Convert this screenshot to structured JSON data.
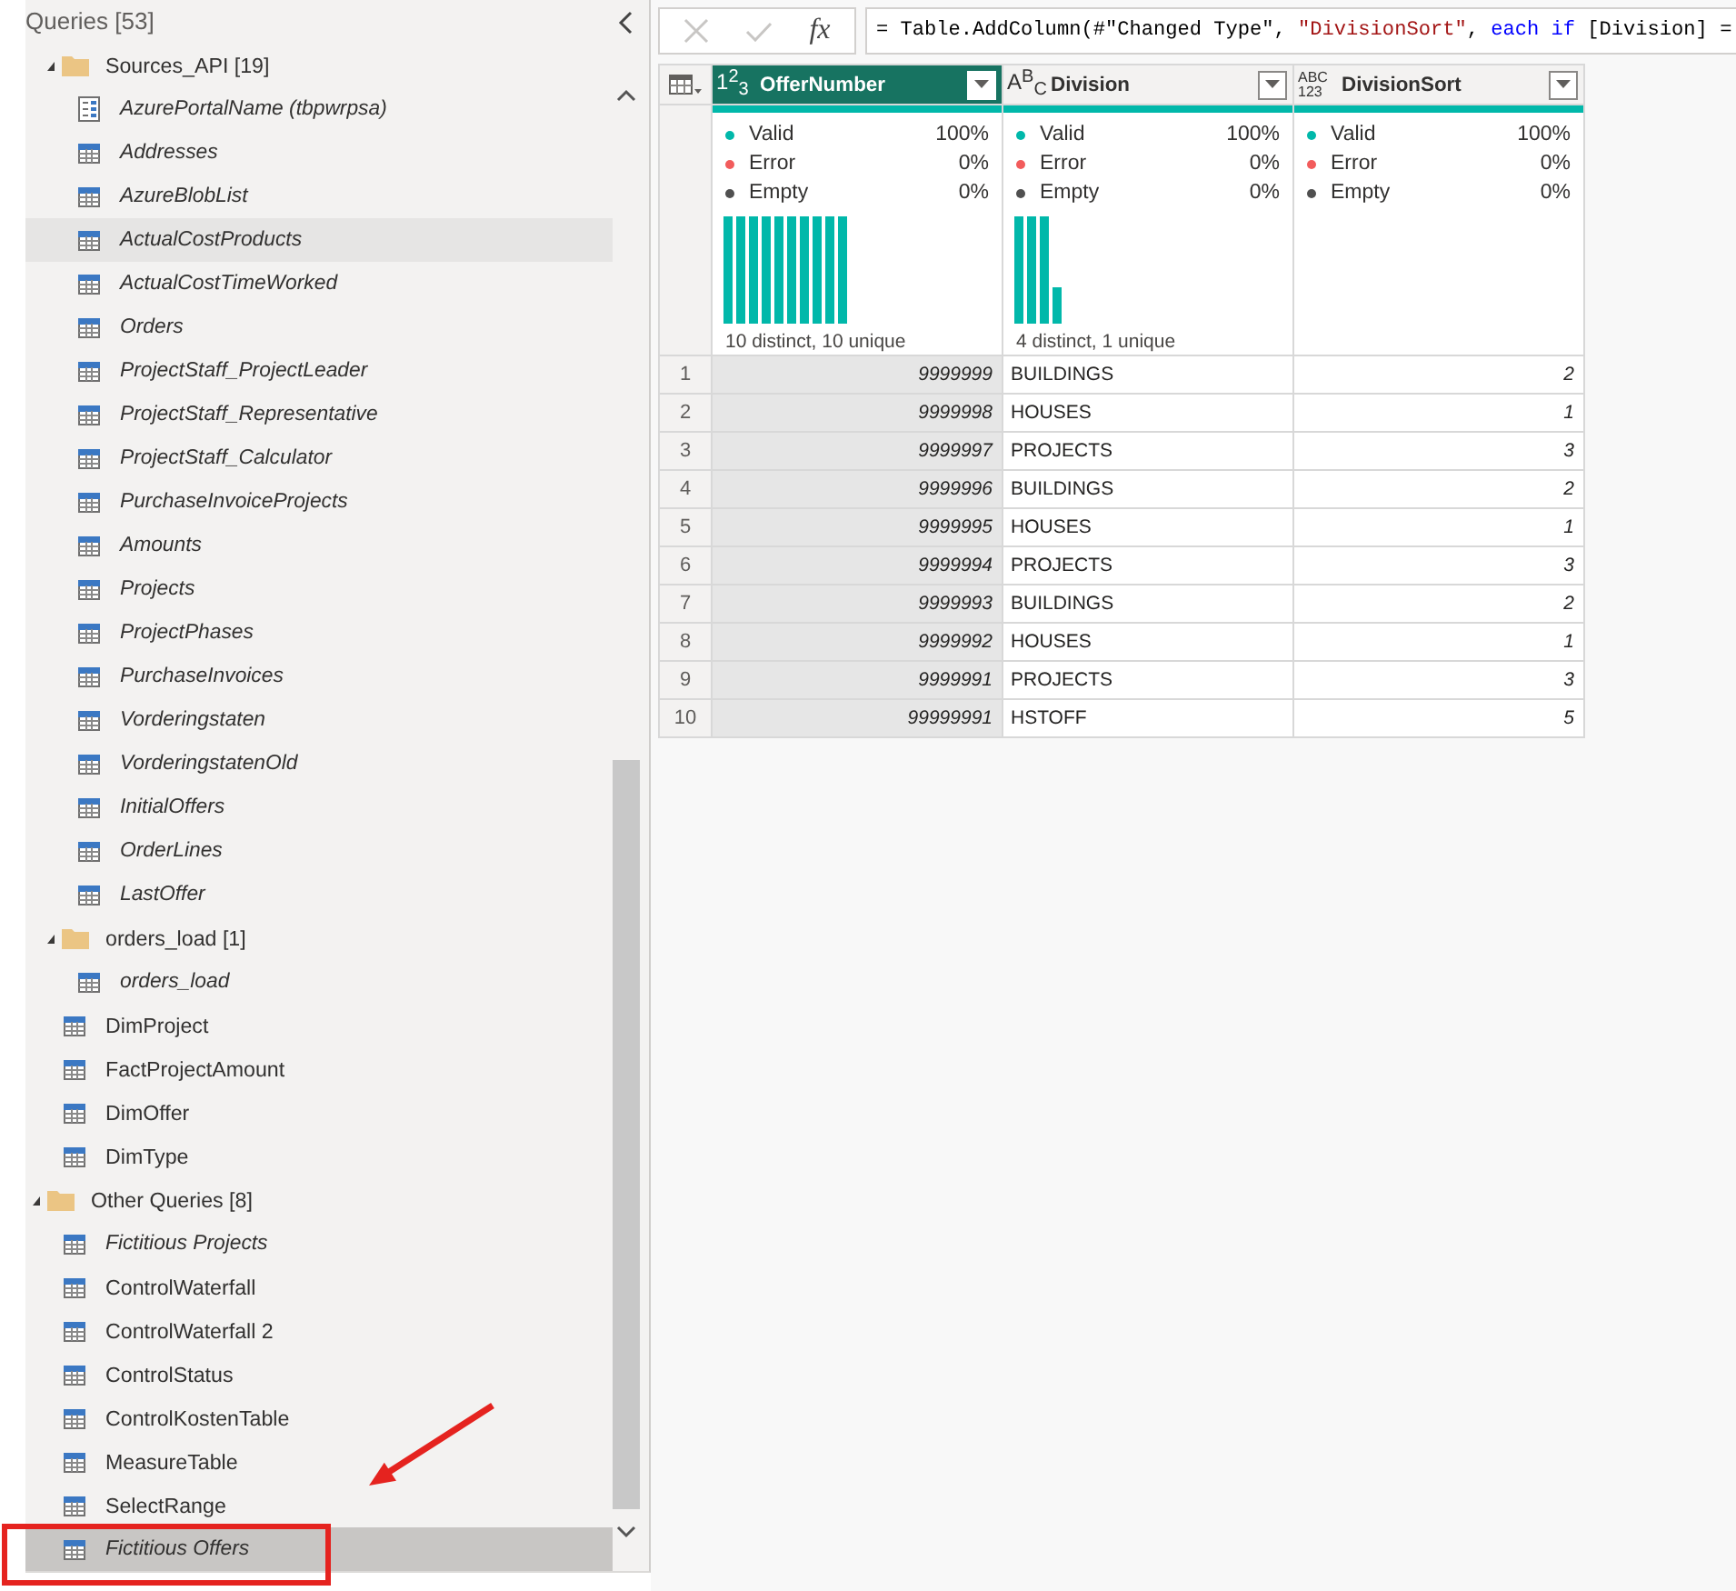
{
  "query_pane": {
    "title": "Queries [53]",
    "tree": [
      {
        "kind": "offscreen",
        "children": [
          {
            "kind": "folder",
            "label": "Sources_API [19]",
            "expanded": true,
            "selected": false,
            "hovered": false,
            "children": [
              {
                "kind": "parameter",
                "label": "AzurePortalName (tbpwrpsa)",
                "load_enabled": false,
                "selected": false,
                "hovered": false
              },
              {
                "kind": "table",
                "label": "Addresses",
                "load_enabled": false,
                "selected": false,
                "hovered": false
              },
              {
                "kind": "table",
                "label": "AzureBlobList",
                "load_enabled": false,
                "selected": false,
                "hovered": false
              },
              {
                "kind": "table",
                "label": "ActualCostProducts",
                "load_enabled": false,
                "selected": false,
                "hovered": true
              },
              {
                "kind": "table",
                "label": "ActualCostTimeWorked",
                "load_enabled": false,
                "selected": false,
                "hovered": false
              },
              {
                "kind": "table",
                "label": "Orders",
                "load_enabled": false,
                "selected": false,
                "hovered": false
              },
              {
                "kind": "table",
                "label": "ProjectStaff_ProjectLeader",
                "load_enabled": false,
                "selected": false,
                "hovered": false
              },
              {
                "kind": "table",
                "label": "ProjectStaff_Representative",
                "load_enabled": false,
                "selected": false,
                "hovered": false
              },
              {
                "kind": "table",
                "label": "ProjectStaff_Calculator",
                "load_enabled": false,
                "selected": false,
                "hovered": false
              },
              {
                "kind": "table",
                "label": "PurchaseInvoiceProjects",
                "load_enabled": false,
                "selected": false,
                "hovered": false
              },
              {
                "kind": "table",
                "label": "Amounts",
                "load_enabled": false,
                "selected": false,
                "hovered": false
              },
              {
                "kind": "table",
                "label": "Projects",
                "load_enabled": false,
                "selected": false,
                "hovered": false
              },
              {
                "kind": "table",
                "label": "ProjectPhases",
                "load_enabled": false,
                "selected": false,
                "hovered": false
              },
              {
                "kind": "table",
                "label": "PurchaseInvoices",
                "load_enabled": false,
                "selected": false,
                "hovered": false
              },
              {
                "kind": "table",
                "label": "Vorderingstaten",
                "load_enabled": false,
                "selected": false,
                "hovered": false
              },
              {
                "kind": "table",
                "label": "VorderingstatenOld",
                "load_enabled": false,
                "selected": false,
                "hovered": false
              },
              {
                "kind": "table",
                "label": "InitialOffers",
                "load_enabled": false,
                "selected": false,
                "hovered": false
              },
              {
                "kind": "table",
                "label": "OrderLines",
                "load_enabled": false,
                "selected": false,
                "hovered": false
              },
              {
                "kind": "table",
                "label": "LastOffer",
                "load_enabled": false,
                "selected": false,
                "hovered": false
              }
            ]
          },
          {
            "kind": "folder",
            "label": "orders_load [1]",
            "expanded": true,
            "selected": false,
            "hovered": false,
            "children": [
              {
                "kind": "table",
                "label": "orders_load",
                "load_enabled": false,
                "selected": false,
                "hovered": false
              }
            ]
          },
          {
            "kind": "table",
            "label": "DimProject",
            "load_enabled": true,
            "selected": false,
            "hovered": false
          },
          {
            "kind": "table",
            "label": "FactProjectAmount",
            "load_enabled": true,
            "selected": false,
            "hovered": false
          },
          {
            "kind": "table",
            "label": "DimOffer",
            "load_enabled": true,
            "selected": false,
            "hovered": false
          },
          {
            "kind": "table",
            "label": "DimType",
            "load_enabled": true,
            "selected": false,
            "hovered": false
          }
        ]
      },
      {
        "kind": "folder",
        "label": "Other Queries [8]",
        "expanded": true,
        "selected": false,
        "hovered": false,
        "children": [
          {
            "kind": "table",
            "label": "Fictitious Projects",
            "load_enabled": false,
            "selected": false,
            "hovered": false
          },
          {
            "kind": "table",
            "label": "ControlWaterfall",
            "load_enabled": true,
            "selected": false,
            "hovered": false
          },
          {
            "kind": "table",
            "label": "ControlWaterfall 2",
            "load_enabled": true,
            "selected": false,
            "hovered": false
          },
          {
            "kind": "table",
            "label": "ControlStatus",
            "load_enabled": true,
            "selected": false,
            "hovered": false
          },
          {
            "kind": "table",
            "label": "ControlKostenTable",
            "load_enabled": true,
            "selected": false,
            "hovered": false
          },
          {
            "kind": "table",
            "label": "MeasureTable",
            "load_enabled": true,
            "selected": false,
            "hovered": false
          },
          {
            "kind": "table",
            "label": "SelectRange",
            "load_enabled": true,
            "selected": false,
            "hovered": false
          },
          {
            "kind": "table",
            "label": "Fictitious Offers",
            "load_enabled": false,
            "selected": true,
            "hovered": false
          }
        ]
      }
    ]
  },
  "formula_bar": {
    "buttons": [
      {
        "kind": "cancel",
        "disabled": true
      },
      {
        "kind": "commit",
        "disabled": true
      }
    ],
    "function_label": "fx",
    "formula": [
      {
        "kind": "plain",
        "text": "= Table.AddColumn(#\"Changed Type\", "
      },
      {
        "kind": "string",
        "text": "\"DivisionSort\""
      },
      {
        "kind": "plain",
        "text": ", "
      },
      {
        "kind": "keyword",
        "text": "each if"
      },
      {
        "kind": "plain",
        "text": " [Division] ="
      }
    ]
  },
  "table": {
    "columns": [
      {
        "name": "OfferNumber",
        "kind": "number",
        "type_glyph": [
          "1",
          "2",
          "3"
        ],
        "selected": true,
        "profile": {
          "level": 1,
          "stats": [
            {
              "label": "Valid",
              "value": "100%",
              "color": "#01b8aa"
            },
            {
              "label": "Error",
              "value": "0%",
              "color": "#f25c5c"
            },
            {
              "label": "Empty",
              "value": "0%",
              "color": "#505050"
            }
          ],
          "distribution_shown": true,
          "summary": "10 distinct, 10 unique"
        }
      },
      {
        "name": "Division",
        "kind": "text",
        "type_glyph": [
          "A",
          "B",
          "C"
        ],
        "selected": false,
        "profile": {
          "level": 1,
          "stats": [
            {
              "label": "Valid",
              "value": "100%",
              "color": "#01b8aa"
            },
            {
              "label": "Error",
              "value": "0%",
              "color": "#f25c5c"
            },
            {
              "label": "Empty",
              "value": "0%",
              "color": "#505050"
            }
          ],
          "distribution_shown": true,
          "summary": "4 distinct, 1 unique"
        }
      },
      {
        "name": "DivisionSort",
        "kind": "any",
        "type_glyph": [
          "ABC",
          "123"
        ],
        "selected": false,
        "profile": {
          "level": 1,
          "stats": [
            {
              "label": "Valid",
              "value": "100%",
              "color": "#01b8aa"
            },
            {
              "label": "Error",
              "value": "0%",
              "color": "#f25c5c"
            },
            {
              "label": "Empty",
              "value": "0%",
              "color": "#505050"
            }
          ],
          "distribution_shown": false
        }
      }
    ],
    "rows": [
      {
        "number": "1",
        "cells": [
          "9999999",
          "BUILDINGS",
          "2"
        ]
      },
      {
        "number": "2",
        "cells": [
          "9999998",
          "HOUSES",
          "1"
        ]
      },
      {
        "number": "3",
        "cells": [
          "9999997",
          "PROJECTS",
          "3"
        ]
      },
      {
        "number": "4",
        "cells": [
          "9999996",
          "BUILDINGS",
          "2"
        ]
      },
      {
        "number": "5",
        "cells": [
          "9999995",
          "HOUSES",
          "1"
        ]
      },
      {
        "number": "6",
        "cells": [
          "9999994",
          "PROJECTS",
          "3"
        ]
      },
      {
        "number": "7",
        "cells": [
          "9999993",
          "BUILDINGS",
          "2"
        ]
      },
      {
        "number": "8",
        "cells": [
          "9999992",
          "HOUSES",
          "1"
        ]
      },
      {
        "number": "9",
        "cells": [
          "9999991",
          "PROJECTS",
          "3"
        ]
      },
      {
        "number": "10",
        "cells": [
          "99999991",
          "HSTOFF",
          "5"
        ]
      }
    ]
  },
  "annotations": {
    "arrow": true,
    "frame": true
  }
}
